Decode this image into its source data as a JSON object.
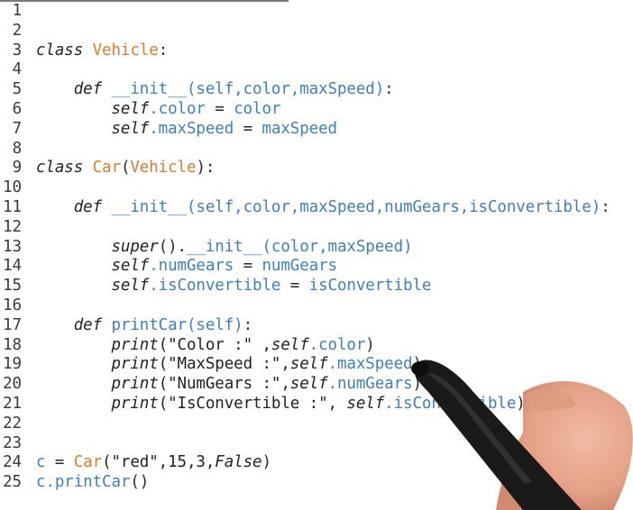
{
  "editor": {
    "lines": [
      {
        "n": "1",
        "tokens": []
      },
      {
        "n": "2",
        "tokens": []
      },
      {
        "n": "3",
        "tokens": [
          {
            "t": "class",
            "c": "kw"
          },
          {
            "t": " ",
            "c": "op"
          },
          {
            "t": "Vehicle",
            "c": "cls"
          },
          {
            "t": ":",
            "c": "op"
          }
        ]
      },
      {
        "n": "4",
        "tokens": []
      },
      {
        "n": "5",
        "tokens": [
          {
            "t": "    ",
            "c": "op"
          },
          {
            "t": "def",
            "c": "kw"
          },
          {
            "t": " ",
            "c": "op"
          },
          {
            "t": "__init__",
            "c": "fn"
          },
          {
            "t": "(self,color,maxSpeed)",
            "c": "id"
          },
          {
            "t": ":",
            "c": "op"
          }
        ]
      },
      {
        "n": "6",
        "tokens": [
          {
            "t": "        ",
            "c": "op"
          },
          {
            "t": "self",
            "c": "it"
          },
          {
            "t": ".color",
            "c": "id"
          },
          {
            "t": " = ",
            "c": "op"
          },
          {
            "t": "color",
            "c": "id"
          }
        ]
      },
      {
        "n": "7",
        "tokens": [
          {
            "t": "        ",
            "c": "op"
          },
          {
            "t": "self",
            "c": "it"
          },
          {
            "t": ".maxSpeed",
            "c": "id"
          },
          {
            "t": " = ",
            "c": "op"
          },
          {
            "t": "maxSpeed",
            "c": "id"
          }
        ]
      },
      {
        "n": "8",
        "tokens": []
      },
      {
        "n": "9",
        "tokens": [
          {
            "t": "class",
            "c": "kw"
          },
          {
            "t": " ",
            "c": "op"
          },
          {
            "t": "Car",
            "c": "cls"
          },
          {
            "t": "(",
            "c": "op"
          },
          {
            "t": "Vehicle",
            "c": "cls"
          },
          {
            "t": "):",
            "c": "op"
          }
        ]
      },
      {
        "n": "10",
        "tokens": []
      },
      {
        "n": "11",
        "tokens": [
          {
            "t": "    ",
            "c": "op"
          },
          {
            "t": "def",
            "c": "kw"
          },
          {
            "t": " ",
            "c": "op"
          },
          {
            "t": "__init__",
            "c": "fn"
          },
          {
            "t": "(self,color,maxSpeed,numGears,isConvertible)",
            "c": "id"
          },
          {
            "t": ":",
            "c": "op"
          }
        ]
      },
      {
        "n": "12",
        "tokens": []
      },
      {
        "n": "13",
        "tokens": [
          {
            "t": "        ",
            "c": "op"
          },
          {
            "t": "super",
            "c": "it"
          },
          {
            "t": "().",
            "c": "op"
          },
          {
            "t": "__init__",
            "c": "fn"
          },
          {
            "t": "(color,maxSpeed)",
            "c": "id"
          }
        ]
      },
      {
        "n": "14",
        "tokens": [
          {
            "t": "        ",
            "c": "op"
          },
          {
            "t": "self",
            "c": "it"
          },
          {
            "t": ".numGears",
            "c": "id"
          },
          {
            "t": " = ",
            "c": "op"
          },
          {
            "t": "numGears",
            "c": "id"
          }
        ]
      },
      {
        "n": "15",
        "tokens": [
          {
            "t": "        ",
            "c": "op"
          },
          {
            "t": "self",
            "c": "it"
          },
          {
            "t": ".isConvertible",
            "c": "id"
          },
          {
            "t": " = ",
            "c": "op"
          },
          {
            "t": "isConvertible",
            "c": "id"
          }
        ]
      },
      {
        "n": "16",
        "tokens": []
      },
      {
        "n": "17",
        "tokens": [
          {
            "t": "    ",
            "c": "op"
          },
          {
            "t": "def",
            "c": "kw"
          },
          {
            "t": " ",
            "c": "op"
          },
          {
            "t": "printCar",
            "c": "fn"
          },
          {
            "t": "(self)",
            "c": "id"
          },
          {
            "t": ":",
            "c": "op"
          }
        ]
      },
      {
        "n": "18",
        "tokens": [
          {
            "t": "        ",
            "c": "op"
          },
          {
            "t": "print",
            "c": "it"
          },
          {
            "t": "(\"Color :\" ,",
            "c": "str"
          },
          {
            "t": "self",
            "c": "it"
          },
          {
            "t": ".color",
            "c": "id"
          },
          {
            "t": ")",
            "c": "op"
          }
        ]
      },
      {
        "n": "19",
        "tokens": [
          {
            "t": "        ",
            "c": "op"
          },
          {
            "t": "print",
            "c": "it"
          },
          {
            "t": "(\"MaxSpeed :\",",
            "c": "str"
          },
          {
            "t": "self",
            "c": "it"
          },
          {
            "t": ".maxSpeed",
            "c": "id"
          },
          {
            "t": ")",
            "c": "op"
          }
        ]
      },
      {
        "n": "20",
        "tokens": [
          {
            "t": "        ",
            "c": "op"
          },
          {
            "t": "print",
            "c": "it"
          },
          {
            "t": "(\"NumGears :\",",
            "c": "str"
          },
          {
            "t": "self",
            "c": "it"
          },
          {
            "t": ".numGears",
            "c": "id"
          },
          {
            "t": ")",
            "c": "op"
          }
        ]
      },
      {
        "n": "21",
        "tokens": [
          {
            "t": "        ",
            "c": "op"
          },
          {
            "t": "print",
            "c": "it"
          },
          {
            "t": "(\"IsConvertible :\", ",
            "c": "str"
          },
          {
            "t": "self",
            "c": "it"
          },
          {
            "t": ".isConvertible",
            "c": "id"
          },
          {
            "t": ")",
            "c": "op"
          }
        ]
      },
      {
        "n": "22",
        "tokens": []
      },
      {
        "n": "23",
        "tokens": []
      },
      {
        "n": "24",
        "tokens": [
          {
            "t": "c",
            "c": "id"
          },
          {
            "t": " = ",
            "c": "op"
          },
          {
            "t": "Car",
            "c": "cls"
          },
          {
            "t": "(\"red\",15,3,",
            "c": "str"
          },
          {
            "t": "False",
            "c": "it"
          },
          {
            "t": ")",
            "c": "op"
          }
        ]
      },
      {
        "n": "25",
        "tokens": [
          {
            "t": "c",
            "c": "id"
          },
          {
            "t": ".printCar",
            "c": "id"
          },
          {
            "t": "()",
            "c": "op"
          }
        ]
      }
    ]
  },
  "colors": {
    "class_name": "#e07a2c",
    "identifier": "#3d7fbf",
    "keyword": "#222222",
    "background": "#ffffff",
    "pen": "#1a1a1a",
    "hand": "#e8a98f"
  },
  "icons": {
    "pen_and_hand": "stylus-hand-icon"
  }
}
